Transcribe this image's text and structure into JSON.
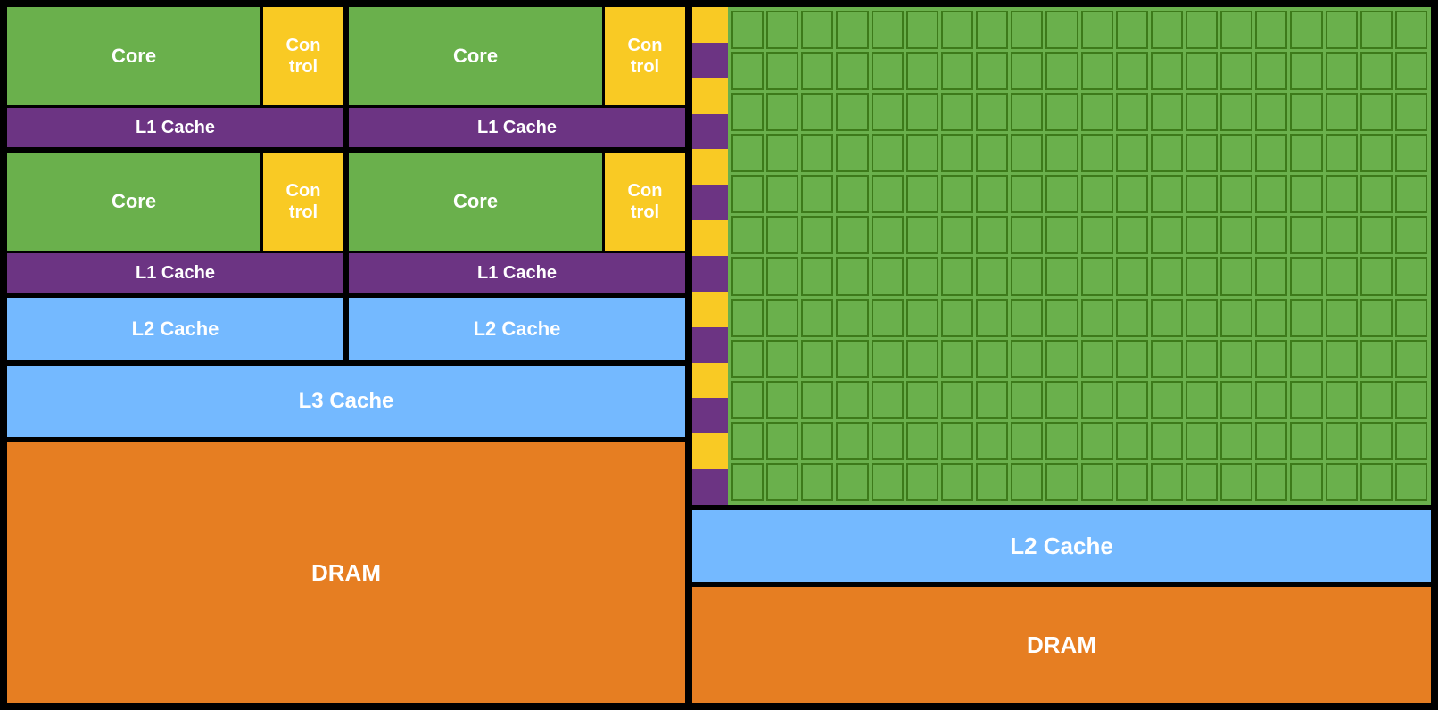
{
  "left": {
    "core1_label": "Core",
    "core2_label": "Core",
    "core3_label": "Core",
    "core4_label": "Core",
    "control_label": "Con\ntrol",
    "l1_cache_label": "L1 Cache",
    "l2_cache_label": "L2 Cache",
    "l3_cache_label": "L3 Cache",
    "dram_label": "DRAM"
  },
  "right": {
    "l2_cache_label": "L2 Cache",
    "dram_label": "DRAM",
    "stripe_count": 14,
    "grid_cols": 20,
    "grid_rows": 12
  }
}
